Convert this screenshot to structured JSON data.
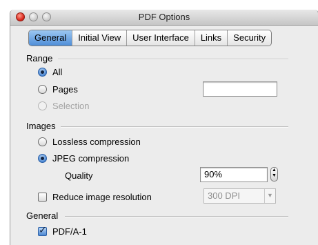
{
  "window": {
    "title": "PDF Options"
  },
  "tabs": [
    {
      "label": "General",
      "active": true
    },
    {
      "label": "Initial View",
      "active": false
    },
    {
      "label": "User Interface",
      "active": false
    },
    {
      "label": "Links",
      "active": false
    },
    {
      "label": "Security",
      "active": false
    }
  ],
  "range": {
    "heading": "Range",
    "all_label": "All",
    "all_selected": true,
    "pages_label": "Pages",
    "pages_value": "",
    "selection_label": "Selection",
    "selection_enabled": false
  },
  "images": {
    "heading": "Images",
    "lossless_label": "Lossless compression",
    "jpeg_label": "JPEG compression",
    "jpeg_selected": true,
    "quality_label": "Quality",
    "quality_value": "90%",
    "reduce_label": "Reduce image resolution",
    "reduce_checked": false,
    "resolution_value": "300 DPI"
  },
  "general": {
    "heading": "General",
    "pdfa_label": "PDF/A-1",
    "pdfa_checked": true
  },
  "colors": {
    "tab_active": "#4f8ed8",
    "window_bg": "#ececec"
  }
}
